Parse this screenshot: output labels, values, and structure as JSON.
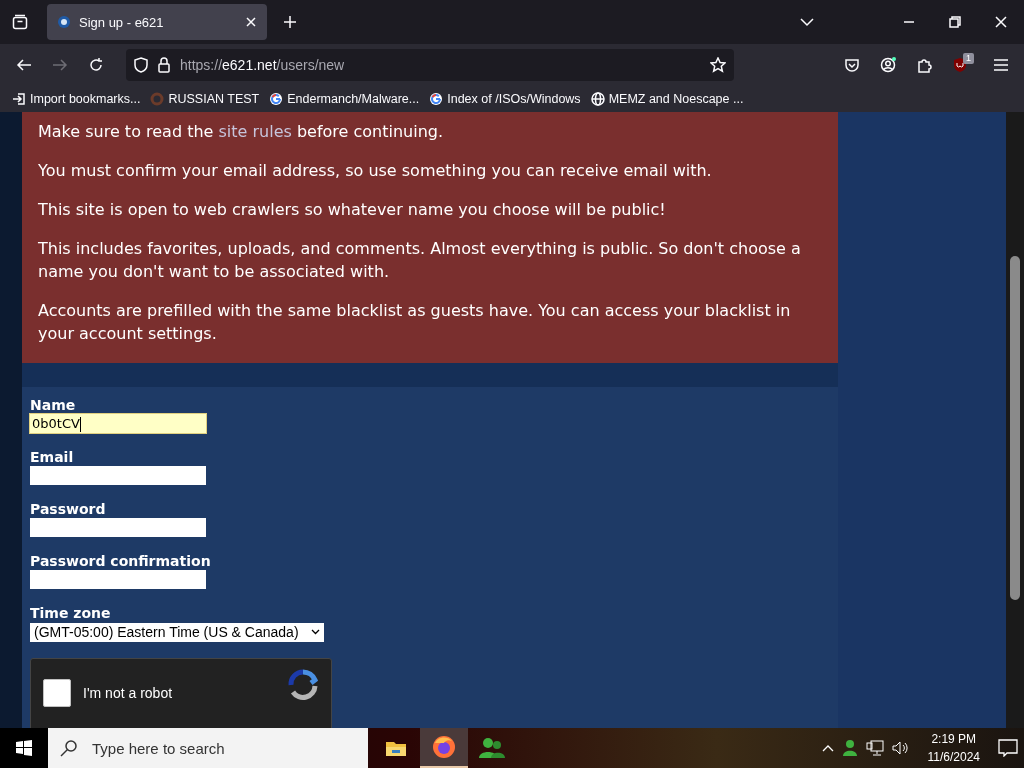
{
  "browser": {
    "tabs": [
      {
        "title": "Sign up - e621",
        "selected": true
      }
    ],
    "url": {
      "host": "e621.net",
      "path": "/users/new",
      "scheme": "https://"
    },
    "extension_badge": "1",
    "bookmarks": [
      {
        "kind": "import",
        "label": "Import bookmarks..."
      },
      {
        "kind": "site",
        "label": "RUSSIAN TEST"
      },
      {
        "kind": "google",
        "label": "Endermanch/Malware..."
      },
      {
        "kind": "google",
        "label": "Index of /ISOs/Windows"
      },
      {
        "kind": "globe",
        "label": "MEMZ and Noescape ..."
      }
    ]
  },
  "notice": {
    "paragraphs": [
      {
        "text": "Make sure to read the ",
        "link": "site rules",
        "after": " before continuing."
      },
      {
        "text": "You must confirm your email address, so use something you can receive email with."
      },
      {
        "text": "This site is open to web crawlers so whatever name you choose will be public!"
      },
      {
        "text": "This includes favorites, uploads, and comments. Almost everything is public. So don't choose a name you don't want to be associated with."
      },
      {
        "text": "Accounts are prefilled with the same blacklist as guests have. You can access your blacklist in your account settings."
      }
    ]
  },
  "form": {
    "fields": [
      {
        "label": "Name",
        "kind": "text",
        "value": "0b0tCV",
        "focused": true
      },
      {
        "label": "Email",
        "kind": "text",
        "focused": false
      },
      {
        "label": "Password",
        "kind": "password",
        "focused": false
      },
      {
        "label": "Password confirmation",
        "kind": "password",
        "focused": false
      },
      {
        "label": "Time zone",
        "kind": "select",
        "value": "(GMT-05:00) Eastern Time (US & Canada)"
      }
    ],
    "captcha": {
      "label": "I'm not a robot",
      "checked": false
    }
  },
  "taskbar": {
    "search": {
      "placeholder": "Type here to search"
    },
    "apps": [
      {
        "kind": "folder",
        "selected": false
      },
      {
        "kind": "firefox",
        "selected": true
      },
      {
        "kind": "people",
        "selected": false
      }
    ],
    "time": "2:19 PM",
    "date": "11/6/2024"
  }
}
